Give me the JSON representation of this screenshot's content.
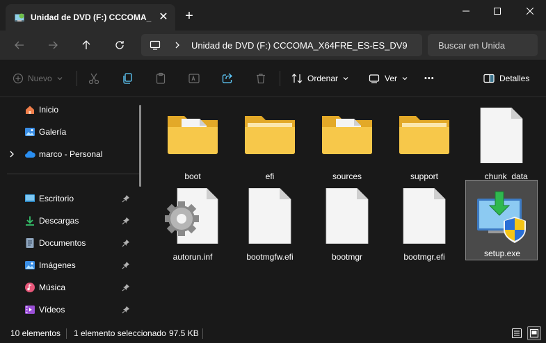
{
  "window": {
    "tab_title": "Unidad de DVD (F:) CCCOMA_",
    "new_tab": "+",
    "close_tab": "✕"
  },
  "address": {
    "path": "Unidad de DVD (F:) CCCOMA_X64FRE_ES-ES_DV9",
    "search_placeholder": "Buscar en Unida"
  },
  "toolbar": {
    "new_label": "Nuevo",
    "sort_label": "Ordenar",
    "view_label": "Ver",
    "more_label": "•••",
    "details_label": "Detalles"
  },
  "sidebar": {
    "top_items": [
      {
        "label": "Inicio",
        "icon": "home-icon"
      },
      {
        "label": "Galería",
        "icon": "gallery-icon"
      },
      {
        "label": "marco - Personal",
        "icon": "onedrive-cloud-icon"
      }
    ],
    "pinned_items": [
      {
        "label": "Escritorio",
        "icon": "desktop-icon"
      },
      {
        "label": "Descargas",
        "icon": "downloads-icon"
      },
      {
        "label": "Documentos",
        "icon": "documents-icon"
      },
      {
        "label": "Imágenes",
        "icon": "pictures-icon"
      },
      {
        "label": "Música",
        "icon": "music-icon"
      },
      {
        "label": "Vídeos",
        "icon": "videos-icon"
      }
    ]
  },
  "files": [
    {
      "name": "boot",
      "kind": "folder-with-doc"
    },
    {
      "name": "efi",
      "kind": "folder"
    },
    {
      "name": "sources",
      "kind": "folder-with-doc"
    },
    {
      "name": "support",
      "kind": "folder"
    },
    {
      "name": "__chunk_data",
      "kind": "file"
    },
    {
      "name": "autorun.inf",
      "kind": "settings-file"
    },
    {
      "name": "bootmgfw.efi",
      "kind": "file"
    },
    {
      "name": "bootmgr",
      "kind": "file"
    },
    {
      "name": "bootmgr.efi",
      "kind": "file"
    },
    {
      "name": "setup.exe",
      "kind": "setup-exe",
      "selected": true
    }
  ],
  "status": {
    "count": "10 elementos",
    "selection": "1 elemento seleccionado",
    "size": "97.5 KB"
  },
  "colors": {
    "folder": "#f5c43c",
    "accent": "#60cdff",
    "background": "#191919"
  }
}
